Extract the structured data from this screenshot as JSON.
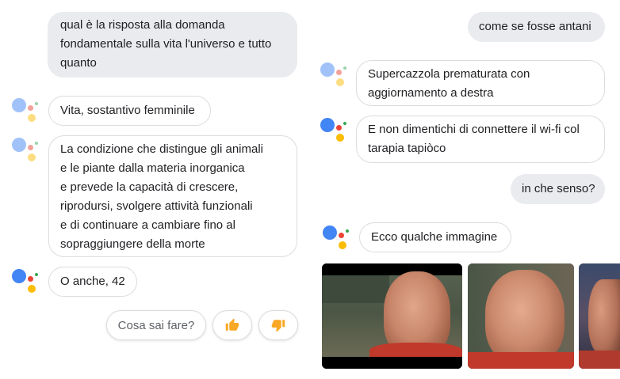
{
  "left_column": {
    "messages": [
      {
        "role": "user",
        "lines": [
          "qual è la risposta alla domanda",
          "fondamentale sulla vita l'universo e tutto",
          "quanto"
        ]
      },
      {
        "role": "assistant",
        "lines": [
          "Vita, sostantivo femminile"
        ]
      },
      {
        "role": "assistant",
        "lines": [
          "La condizione che distingue gli animali",
          "e le piante dalla materia inorganica",
          "e prevede la capacità di crescere,",
          "riprodursi, svolgere attività funzionali",
          "e di continuare a cambiare fino al",
          "sopraggiungere della morte"
        ]
      },
      {
        "role": "assistant",
        "lines": [
          "O anche, 42"
        ]
      }
    ],
    "suggestions": {
      "chip_label": "Cosa sai fare?",
      "thumbs_up_icon": "thumbs-up-icon",
      "thumbs_down_icon": "thumbs-down-icon"
    }
  },
  "right_column": {
    "messages": [
      {
        "role": "user",
        "lines": [
          "come se fosse antani"
        ]
      },
      {
        "role": "assistant",
        "lines": [
          "Supercazzola prematurata con",
          "aggiornamento a destra"
        ]
      },
      {
        "role": "assistant",
        "lines": [
          "E non dimentichi di connettere il wi-fi col",
          "tarapia tapiòco"
        ]
      },
      {
        "role": "user",
        "lines": [
          "in che senso?"
        ]
      },
      {
        "role": "assistant",
        "lines": [
          "Ecco qualche immagine"
        ]
      }
    ],
    "images": [
      "image-result-1",
      "image-result-2",
      "image-result-3"
    ]
  },
  "colors": {
    "user_bubble": "#e9ebef",
    "assistant_border": "#dadce0",
    "text": "#202124",
    "chip_text": "#5f6368",
    "thumb_icon": "#f9a825",
    "google_blue": "#4285f4",
    "google_red": "#ea4335",
    "google_yellow": "#fbbc04",
    "google_green": "#34a853"
  }
}
